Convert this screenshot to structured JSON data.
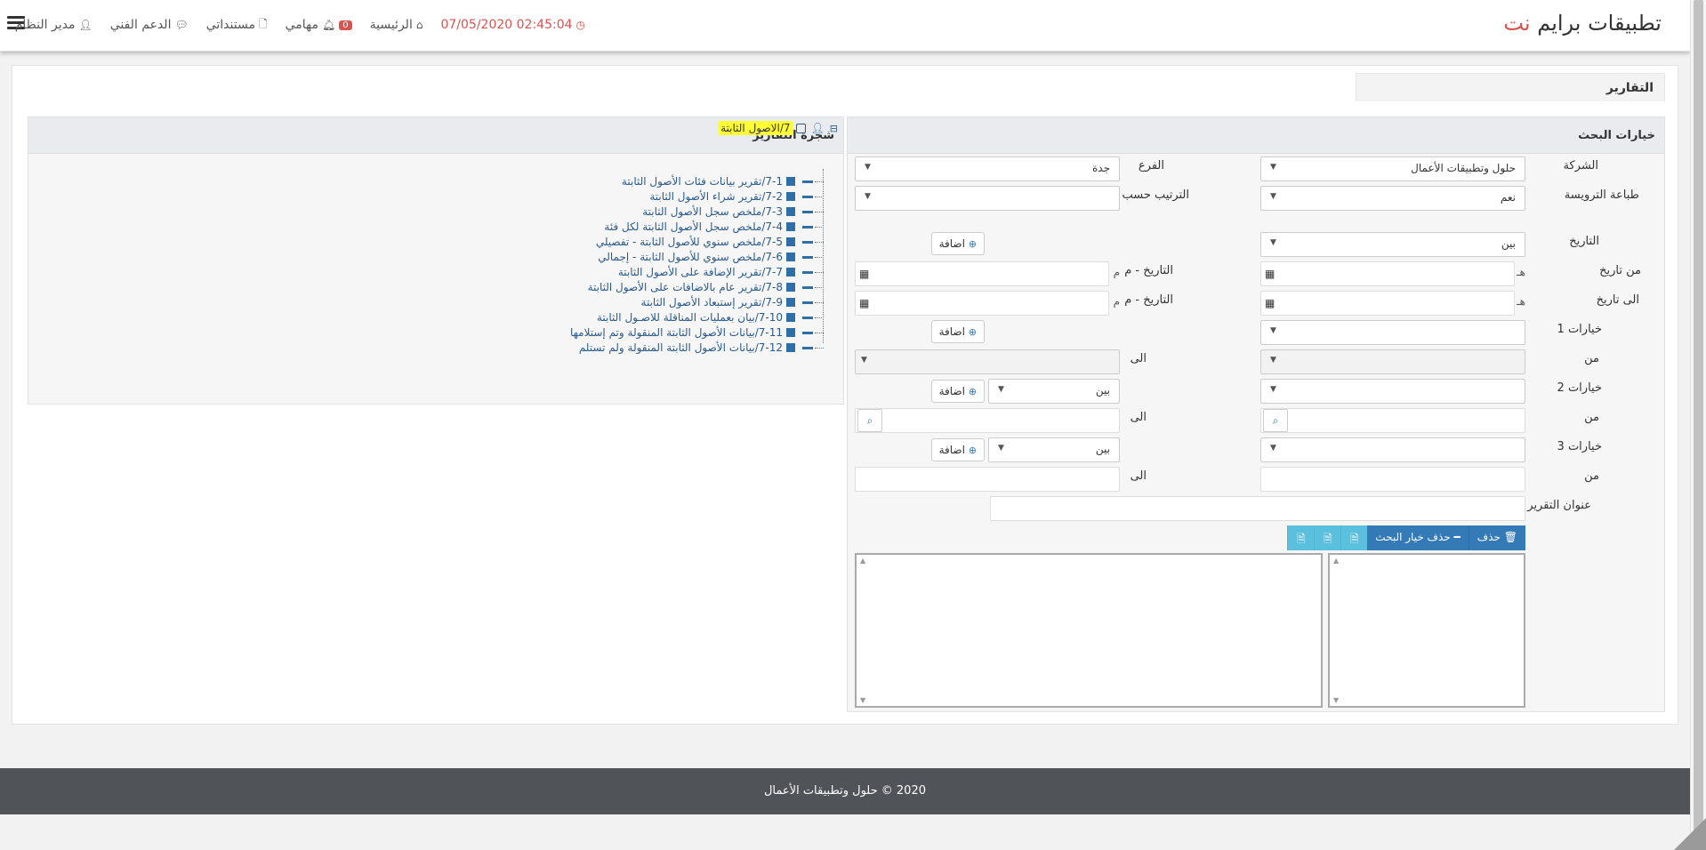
{
  "brand": {
    "prefix": "تطبيقات برايم",
    "accent": "نت"
  },
  "nav": {
    "datetime": "02:45:04 07/05/2020",
    "home": "الرئيسية",
    "tasks": "مهامي",
    "tasks_badge": "0",
    "documents": "مستنداتي",
    "support": "الدعم الفني",
    "user": "مدير النظام"
  },
  "page": {
    "tab_title": "التقارير"
  },
  "search": {
    "title": "خيارات البحث",
    "company_label": "الشركة",
    "company_value": "حلول وتطبيقات الأعمال",
    "branch_label": "الفرع",
    "branch_value": "جدة",
    "print_header_label": "طباعة الترويسة",
    "print_header_value": "نعم",
    "sort_label": "الترتيب حسب",
    "sort_value": "",
    "date_label": "التاريخ",
    "date_value": "بين",
    "add_label": "اضافة",
    "from_date_label": "من تاريخ",
    "to_date_label": "الى تاريخ",
    "hijri_addon": "هـ",
    "greg_addon": "م",
    "greg_date_label": "التاريخ - م",
    "opt1_label": "خيارات 1",
    "opt2_label": "خيارات 2",
    "opt3_label": "خيارات 3",
    "from_label": "من",
    "to_label": "الى",
    "between_value": "بين",
    "report_title_label": "عنوان التقرير",
    "delete_label": "حذف",
    "delete_search_option_label": "حذف خيار البحث"
  },
  "tree": {
    "title": "شجرة التقارير",
    "root": "7/الاصول الثابتة",
    "items": [
      "7-1/تقرير بيانات فئات الأصول الثابتة",
      "7-2/تقرير شراء الأصول الثابتة",
      "7-3/ملخص سجل الأصول الثابتة",
      "7-4/ملخص سجل الأصول الثابتة لكل فئة",
      "7-5/ملخص سنوي للأصول الثابتة - تفصيلي",
      "7-6/ملخص سنوي للأصول الثابتة - إجمالي",
      "7-7/تقرير الإضافة على الأصول الثابتة",
      "7-8/تقرير عام بالاضافات على الأصول الثابتة",
      "7-9/تقرير إستبعاد الأصول الثابتة",
      "7-10/بيان بعمليات المناقلة للاصـول الثابتة",
      "7-11/بيانات الأصول الثابتة المنقولة وتم إستلامها",
      "7-12/بيانات الأصول الثابتة المنقولة ولم تستلم"
    ]
  },
  "footer": {
    "text": "2020 © حلول وتطبيقات الأعمال"
  }
}
